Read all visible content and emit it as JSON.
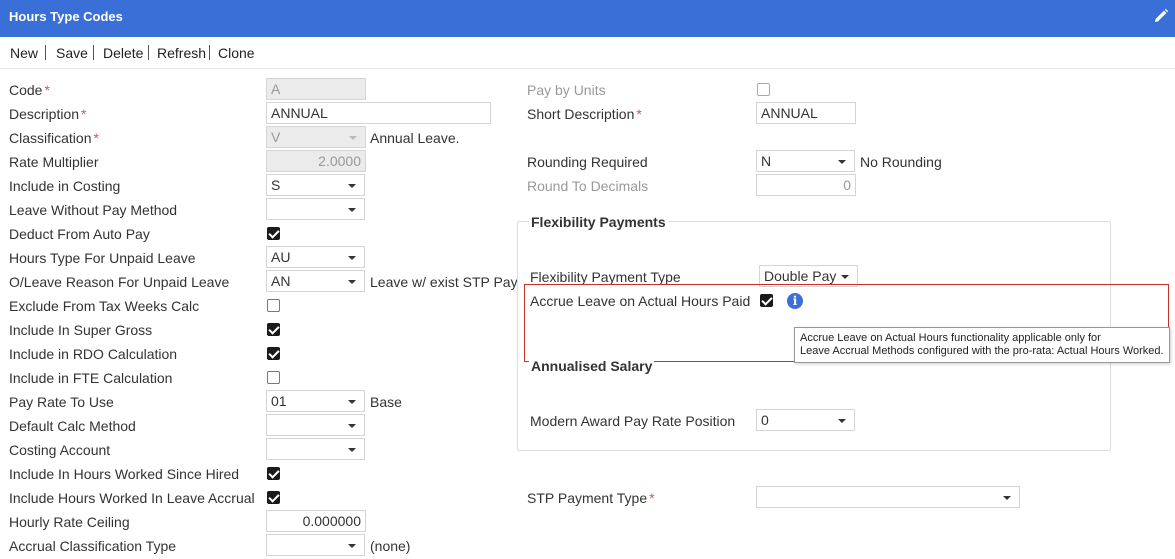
{
  "window": {
    "title": "Hours Type Codes",
    "edit_icon": "pencil-icon",
    "accent": "#3a6fd8"
  },
  "toolbar": {
    "new": "New",
    "save": "Save",
    "delete": "Delete",
    "refresh": "Refresh",
    "clone": "Clone"
  },
  "left": {
    "code": {
      "label": "Code",
      "value": "A"
    },
    "description": {
      "label": "Description",
      "value": "ANNUAL"
    },
    "classification": {
      "label": "Classification",
      "value": "V",
      "after": "Annual Leave."
    },
    "rate_multiplier": {
      "label": "Rate Multiplier",
      "value": "2.0000"
    },
    "include_in_costing": {
      "label": "Include in Costing",
      "value": "S"
    },
    "lwop_method": {
      "label": "Leave Without Pay Method",
      "value": ""
    },
    "deduct_from_auto_pay": {
      "label": "Deduct From Auto Pay",
      "checked": true
    },
    "hours_type_unpaid_leave": {
      "label": "Hours Type For Unpaid Leave",
      "value": "AU"
    },
    "oleave_reason": {
      "label": "O/Leave Reason For Unpaid Leave",
      "value": "AN",
      "after": "Leave w/ exist STP Pay"
    },
    "exclude_tax_weeks": {
      "label": "Exclude From Tax Weeks Calc",
      "checked": false
    },
    "include_super_gross": {
      "label": "Include In Super Gross",
      "checked": true
    },
    "include_rdo": {
      "label": "Include in RDO Calculation",
      "checked": true
    },
    "include_fte": {
      "label": "Include in FTE Calculation",
      "checked": false
    },
    "pay_rate_to_use": {
      "label": "Pay Rate To Use",
      "value": "01",
      "after": "Base"
    },
    "default_calc_method": {
      "label": "Default Calc Method",
      "value": ""
    },
    "costing_account": {
      "label": "Costing Account",
      "value": ""
    },
    "include_hours_since_hired": {
      "label": "Include In Hours Worked Since Hired",
      "checked": true
    },
    "include_hours_leave_accrual": {
      "label": "Include Hours Worked In Leave Accrual",
      "checked": true
    },
    "hourly_rate_ceiling": {
      "label": "Hourly Rate Ceiling",
      "value": "0.000000"
    },
    "accrual_classification_type": {
      "label": "Accrual Classification Type",
      "value": "",
      "after": "(none)"
    }
  },
  "right": {
    "pay_by_units": {
      "label": "Pay by Units",
      "checked": false
    },
    "short_description": {
      "label": "Short Description",
      "value": "ANNUAL"
    },
    "rounding_required": {
      "label": "Rounding Required",
      "value": "N",
      "after": "No Rounding"
    },
    "round_to_decimals": {
      "label": "Round To Decimals",
      "value": "0"
    },
    "flex_group": {
      "title": "Flexibility Payments",
      "payment_type": {
        "label": "Flexibility Payment Type",
        "value": "Double Pay"
      },
      "accrue_leave": {
        "label": "Accrue Leave on Actual Hours Paid",
        "checked": true,
        "info_icon": "info-icon"
      }
    },
    "tooltip": {
      "line1": "Accrue Leave on Actual Hours functionality applicable only for",
      "line2": "Leave Accrual Methods configured with the pro-rata: Actual Hours Worked."
    },
    "salary_group": {
      "title": "Annualised Salary",
      "modern_award_position": {
        "label": "Modern Award Pay Rate Position",
        "value": "0"
      }
    },
    "stp_payment_type": {
      "label": "STP Payment Type",
      "value": ""
    }
  }
}
